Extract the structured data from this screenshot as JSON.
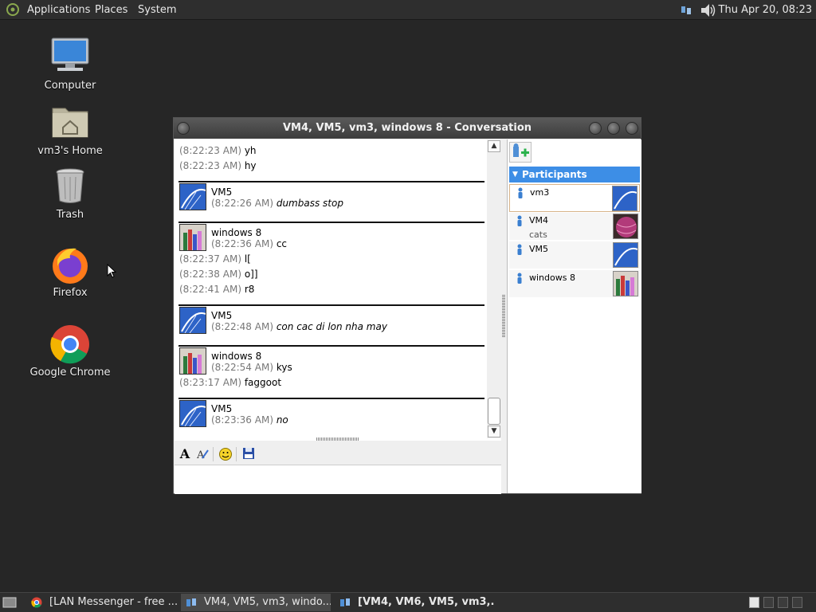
{
  "top_panel": {
    "menus": [
      "Applications",
      "Places",
      "System"
    ],
    "clock": "Thu Apr 20, 08:23",
    "icons": [
      "network-icon",
      "volume-icon"
    ]
  },
  "desktop": {
    "icons": [
      {
        "label": "Computer",
        "icon": "computer-icon"
      },
      {
        "label": "vm3's Home",
        "icon": "home-folder-icon"
      },
      {
        "label": "Trash",
        "icon": "trash-icon"
      },
      {
        "label": "Firefox",
        "icon": "firefox-icon"
      },
      {
        "label": "Google Chrome",
        "icon": "chrome-icon"
      }
    ]
  },
  "window": {
    "title": "VM4, VM5, vm3, windows 8 - Conversation",
    "messages": [
      {
        "time": "(8:22:23 AM)",
        "text": "yh"
      },
      {
        "time": "(8:22:23 AM)",
        "text": "hy"
      },
      {
        "sender": "VM5",
        "time": "(8:22:26 AM)",
        "text": "dumbass stop"
      },
      {
        "sender": "windows 8",
        "time": "(8:22:36 AM)",
        "text": "cc"
      },
      {
        "time": "(8:22:37 AM)",
        "text": "l["
      },
      {
        "time": "(8:22:38 AM)",
        "text": "o]]"
      },
      {
        "time": "(8:22:41 AM)",
        "text": "r8"
      },
      {
        "sender": "VM5",
        "time": "(8:22:48 AM)",
        "text": "con cac di lon nha may"
      },
      {
        "sender": "windows 8",
        "time": "(8:22:54 AM)",
        "text": "kys"
      },
      {
        "time": "(8:23:17 AM)",
        "text": "faggoot"
      },
      {
        "sender": "VM5",
        "time": "(8:23:36 AM)",
        "text": "no"
      }
    ],
    "toolbar": [
      "font-icon",
      "font-color-icon",
      "smiley-icon",
      "save-icon"
    ],
    "participants_header": "Participants",
    "participants": [
      {
        "name": "vm3",
        "status": ""
      },
      {
        "name": "VM4",
        "status": "cats"
      },
      {
        "name": "VM5",
        "status": ""
      },
      {
        "name": "windows 8",
        "status": ""
      }
    ]
  },
  "taskbar": {
    "tasks": [
      {
        "label": "[LAN Messenger - free ...",
        "icon": "chrome-icon",
        "active": false
      },
      {
        "label": "VM4, VM5, vm3, windo...",
        "icon": "messenger-icon",
        "active": true
      },
      {
        "label": "[VM4, VM6, VM5, vm3,...",
        "icon": "messenger-icon",
        "active": false
      }
    ]
  }
}
